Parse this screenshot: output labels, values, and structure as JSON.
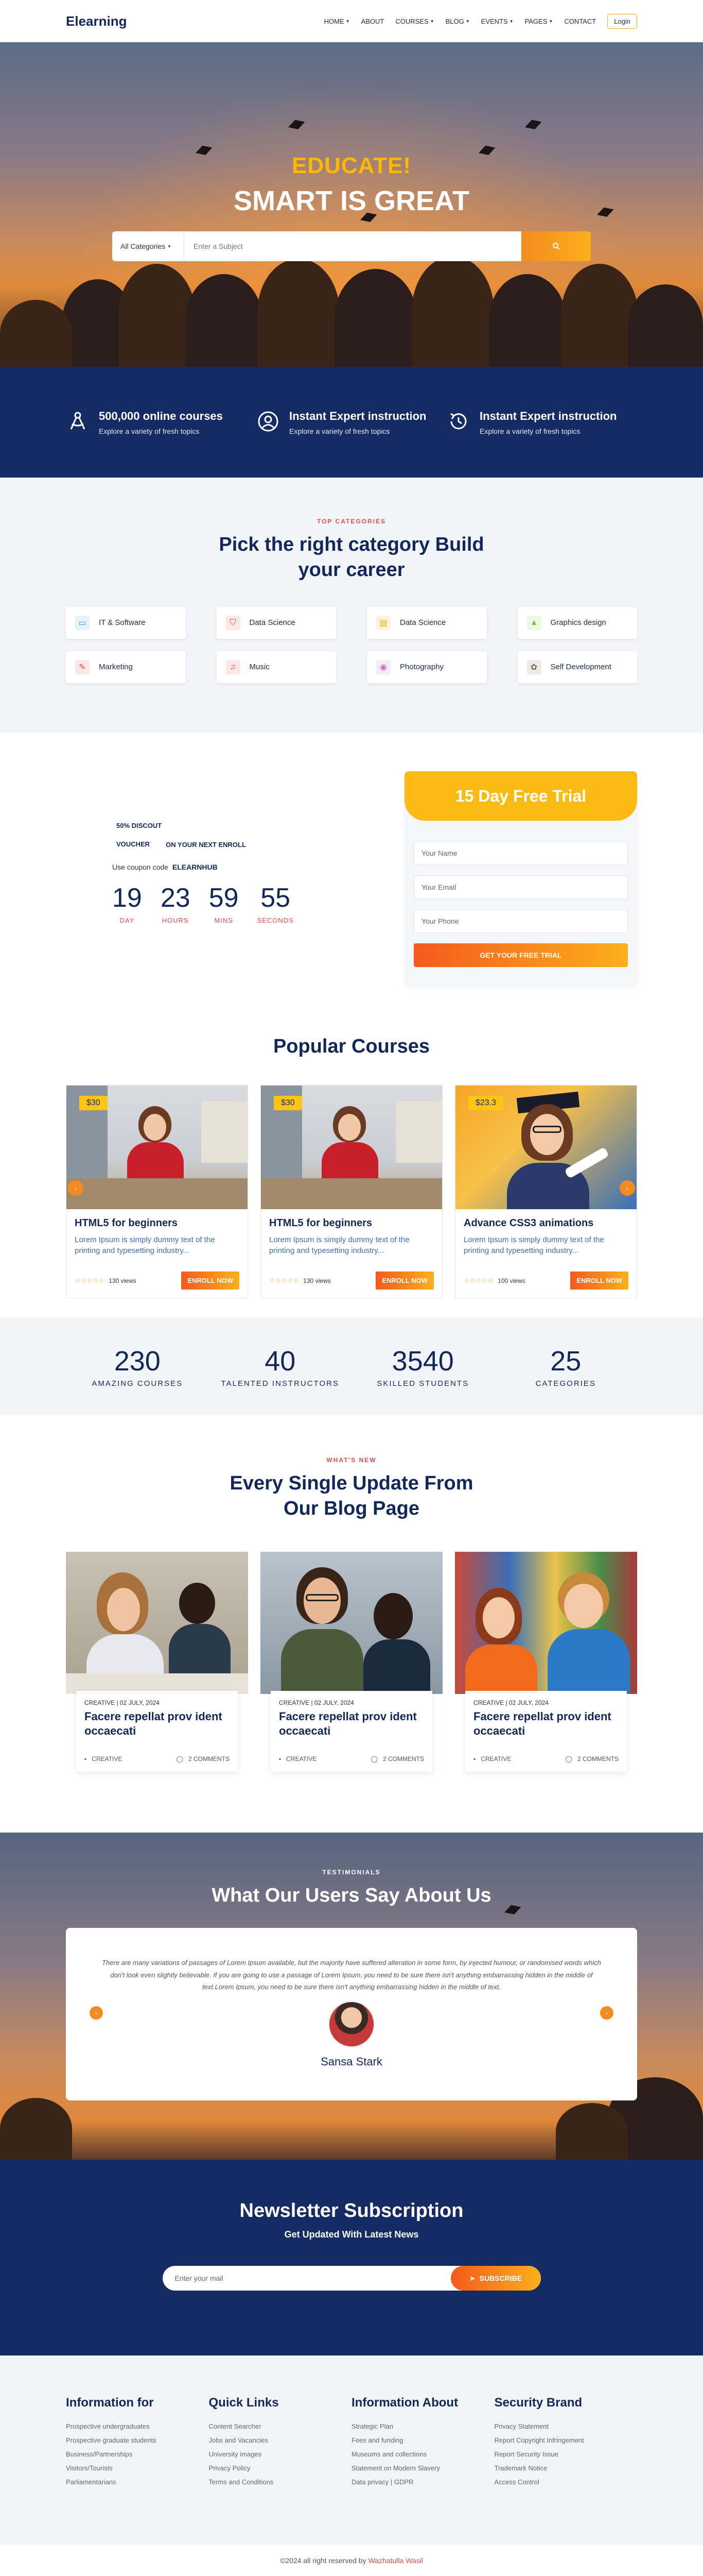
{
  "nav": {
    "logo": "Elearning",
    "items": [
      {
        "label": "HOME",
        "caret": true
      },
      {
        "label": "ABOUT",
        "caret": false
      },
      {
        "label": "COURSES",
        "caret": true
      },
      {
        "label": "BLOG",
        "caret": true
      },
      {
        "label": "EVENTS",
        "caret": true
      },
      {
        "label": "PAGES",
        "caret": true
      },
      {
        "label": "CONTACT",
        "caret": false
      }
    ],
    "login": "Login"
  },
  "hero": {
    "subtitle": "EDUCATE!",
    "title": "SMART IS GREAT",
    "category": "All Categories",
    "search_placeholder": "Enter a Subject"
  },
  "features": [
    {
      "icon": "compass-icon",
      "title": "500,000 online courses",
      "text": "Explore a variety of fresh topics"
    },
    {
      "icon": "user-circle-icon",
      "title": "Instant Expert instruction",
      "text": "Explore a variety of fresh topics"
    },
    {
      "icon": "history-icon",
      "title": "Instant Expert instruction",
      "text": "Explore a variety of fresh topics"
    }
  ],
  "categories": {
    "kicker": "TOP CATEGORIES",
    "title_line1": "Pick the right category Build",
    "title_line2": "your career",
    "items": [
      {
        "label": "IT & Software",
        "icon": "monitor-icon",
        "color": "#2f9be0",
        "glyph": "▭"
      },
      {
        "label": "Data Science",
        "icon": "shield-icon",
        "color": "#e84a4a",
        "glyph": "⛉"
      },
      {
        "label": "Data Science",
        "icon": "folder-chart-icon",
        "color": "#f5a623",
        "glyph": "▤"
      },
      {
        "label": "Graphics design",
        "icon": "landscape-icon",
        "color": "#7fbf3f",
        "glyph": "▲"
      },
      {
        "label": "Marketing",
        "icon": "megaphone-icon",
        "color": "#e84a4a",
        "glyph": "✎"
      },
      {
        "label": "Music",
        "icon": "music-icon",
        "color": "#e84a4a",
        "glyph": "♫"
      },
      {
        "label": "Photography",
        "icon": "camera-icon",
        "color": "#c86ad0",
        "glyph": "◉"
      },
      {
        "label": "Self Development",
        "icon": "brain-icon",
        "color": "#7a6a5a",
        "glyph": "✿"
      }
    ]
  },
  "voucher": {
    "title_line1": "50% DISCOUT",
    "title_line2": "VOUCHER",
    "subtitle": "ON YOUR NEXT ENROLL",
    "code_label": "Use coupon code",
    "code": "ELEARNHUB",
    "countdown": [
      {
        "value": "19",
        "label": "DAY"
      },
      {
        "value": "23",
        "label": "HOURS"
      },
      {
        "value": "59",
        "label": "MINS"
      },
      {
        "value": "55",
        "label": "SECONDS"
      }
    ]
  },
  "trial": {
    "title": "15 Day Free Trial",
    "name_placeholder": "Your Name",
    "email_placeholder": "Your Email",
    "phone_placeholder": "Your Phone",
    "button": "GET YOUR FREE TRIAL"
  },
  "popular": {
    "title": "Popular Courses",
    "courses": [
      {
        "price": "$30",
        "title": "HTML5 for beginners",
        "text": "Lorem Ipsum is simply dummy text of the printing and typesetting industry...",
        "stars": "☆☆☆☆☆",
        "views": "130 views",
        "button": "ENROLL NOW"
      },
      {
        "price": "$30",
        "title": "HTML5 for beginners",
        "text": "Lorem Ipsum is simply dummy text of the printing and typesetting industry...",
        "stars": "☆☆☆☆☆",
        "views": "130 views",
        "button": "ENROLL NOW"
      },
      {
        "price": "$23.3",
        "title": "Advance CSS3 animations",
        "text": "Lorem Ipsum is simply dummy text of the printing and typesetting industry...",
        "stars": "☆☆☆☆☆",
        "views": "100 views",
        "button": "ENROLL NOW"
      }
    ]
  },
  "stats": [
    {
      "value": "230",
      "label": "AMAZING COURSES"
    },
    {
      "value": "40",
      "label": "TALENTED INSTRUCTORS"
    },
    {
      "value": "3540",
      "label": "SKILLED STUDENTS"
    },
    {
      "value": "25",
      "label": "CATEGORIES"
    }
  ],
  "blog": {
    "kicker": "WHAT'S NEW",
    "title_line1": "Every Single Update From",
    "title_line2": "Our Blog Page",
    "posts": [
      {
        "meta": "CREATIVE | 02 JULY, 2024",
        "title": "Facere repellat prov ident occaecati",
        "category": "CREATIVE",
        "comments": "2 COMMENTS"
      },
      {
        "meta": "CREATIVE | 02 JULY, 2024",
        "title": "Facere repellat prov ident occaecati",
        "category": "CREATIVE",
        "comments": "2 COMMENTS"
      },
      {
        "meta": "CREATIVE | 02 JULY, 2024",
        "title": "Facere repellat prov ident occaecati",
        "category": "CREATIVE",
        "comments": "2 COMMENTS"
      }
    ]
  },
  "testimonials": {
    "kicker": "TESTIMONIALS",
    "title": "What Our Users Say About Us",
    "quote": "There are many variations of passages of Lorem Ipsum available, but the majority have suffered alteration in some form, by injected humour, or randomised words which don't look even slightly believable. If you are going to use a passage of Lorem Ipsum, you need to be sure there isn't anything embarrassing hidden in the middle of text.Lorem Ipsum, you need to be sure there isn't anything embarrassing hidden in the middle of text.",
    "name": "Sansa Stark"
  },
  "newsletter": {
    "title": "Newsletter Subscription",
    "subtitle": "Get Updated With Latest News",
    "placeholder": "Enter your mail",
    "button": "SUBSCRIBE"
  },
  "footer": {
    "columns": [
      {
        "title": "Information for",
        "links": [
          "Prospective undergraduates",
          "Prospective graduate students",
          "Business/Partnerships",
          "Visitors/Tourists",
          "Parliamentarians"
        ]
      },
      {
        "title": "Quick Links",
        "links": [
          "Content Searcher",
          "Jobs and Vacancies",
          "University images",
          "Privacy Policy",
          "Terms and Conditions"
        ]
      },
      {
        "title": "Information About",
        "links": [
          "Strategic Plan",
          "Fees and funding",
          "Museums and collections",
          "Statement on Modern Slavery",
          "Data privacy | GDPR"
        ]
      },
      {
        "title": "Security Brand",
        "links": [
          "Privacy Statement",
          "Report Copyright Infringement",
          "Report Security Issue",
          "Trademark Notice",
          "Access Control"
        ]
      }
    ],
    "copyright": "©2024 all right reserved by",
    "author": "Wazhatulla Wasil"
  },
  "colors": {
    "navy": "#152b63",
    "accent_orange": "#f58a1f",
    "accent_yellow": "#fbba14",
    "kicker_red": "#e84a4a"
  }
}
